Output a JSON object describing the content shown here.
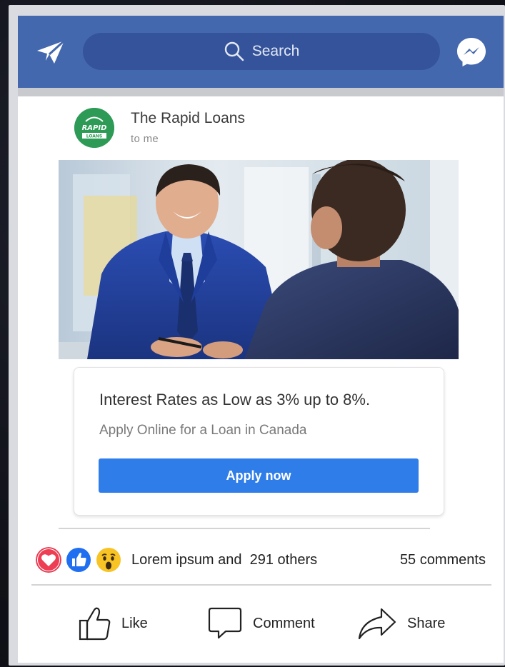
{
  "topbar": {
    "search_placeholder": "Search",
    "left_icon": "paper-plane-icon",
    "right_icon": "messenger-icon",
    "background_color": "#4468ad"
  },
  "post": {
    "sender_name": "The Rapid Loans",
    "sender_sub": "to me",
    "avatar_logo_text": [
      "RAPID",
      "LOANS"
    ],
    "avatar_color": "#2d9a55"
  },
  "ad": {
    "headline": "Interest Rates as Low as 3% up to 8%.",
    "subline": "Apply Online for a Loan in Canada",
    "cta_label": "Apply now",
    "cta_color": "#2f7de9"
  },
  "engagement": {
    "reaction_icons": [
      "heart-icon",
      "thumbs-up-icon",
      "wow-face-icon"
    ],
    "reactions_text": "Lorem ipsum and  291 others",
    "comments_text": "55 comments"
  },
  "actions": {
    "like_label": "Like",
    "comment_label": "Comment",
    "share_label": "Share"
  }
}
